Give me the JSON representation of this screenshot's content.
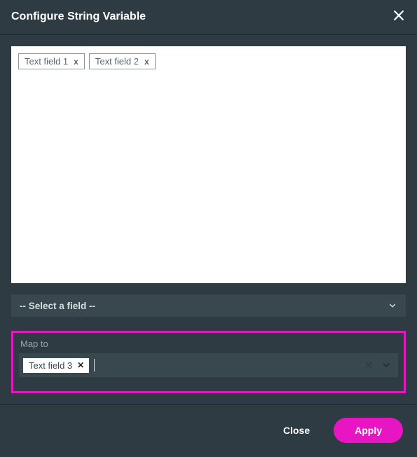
{
  "header": {
    "title": "Configure String Variable"
  },
  "panel": {
    "tags": [
      {
        "label": "Text field 1"
      },
      {
        "label": "Text field 2"
      }
    ]
  },
  "select": {
    "placeholder": "-- Select a field --"
  },
  "mapTo": {
    "label": "Map to",
    "selected": {
      "label": "Text field 3"
    }
  },
  "footer": {
    "close": "Close",
    "apply": "Apply"
  },
  "colors": {
    "accent": "#e815c3",
    "surface": "#2e3b42",
    "control": "#39474f"
  }
}
